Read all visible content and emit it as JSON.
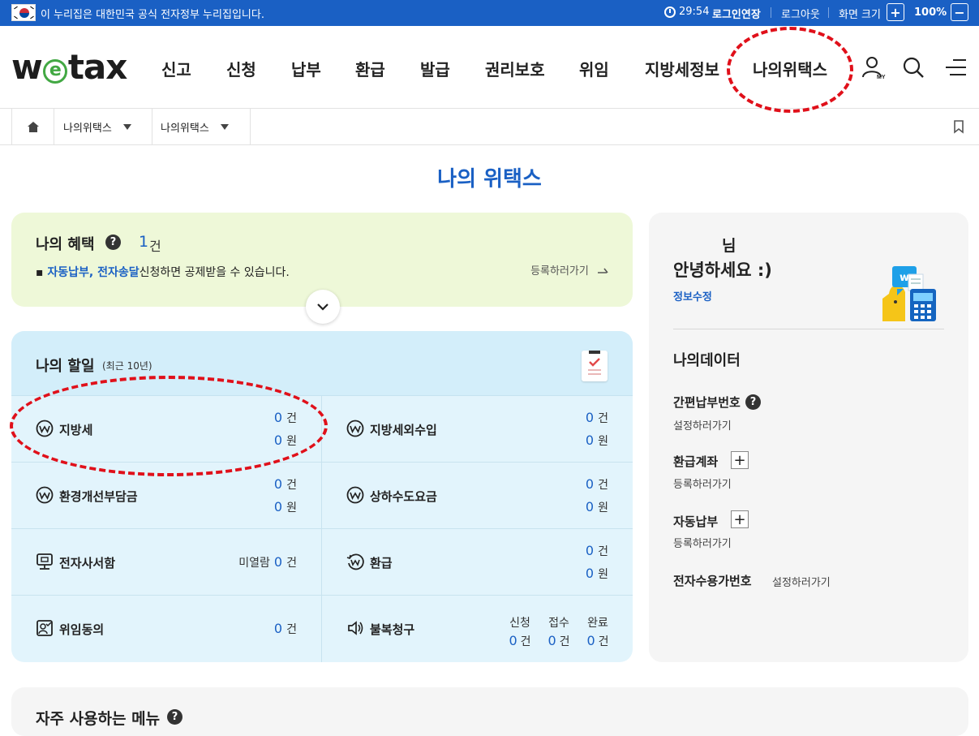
{
  "topbar": {
    "gov_notice": "이 누리집은 대한민국 공식 전자정부 누리집입니다.",
    "timer": "29:54",
    "extend_login": "로그인연장",
    "logout": "로그아웃",
    "zoom_label": "화면 크기",
    "zoom_in": "+",
    "zoom_value": "100%",
    "zoom_out": "−"
  },
  "header": {
    "logo_pre": "w",
    "logo_e": "e",
    "logo_post": "tax",
    "nav": [
      "신고",
      "신청",
      "납부",
      "환급",
      "발급",
      "권리보호",
      "위임",
      "지방세정보",
      "나의위택스"
    ],
    "icons": [
      "user-my-icon",
      "search-icon",
      "menu-icon"
    ],
    "my_label": "MY"
  },
  "breadcrumb": {
    "level1": "나의위택스",
    "level2": "나의위택스"
  },
  "page_title": "나의 위택스",
  "benefit": {
    "title": "나의 혜택",
    "help": "?",
    "count": "1",
    "count_unit": "건",
    "desc_highlight": "자동납부, 전자송달",
    "desc_rest": "신청하면 공제받을 수 있습니다.",
    "register_link": "등록하러가기"
  },
  "todo": {
    "title": "나의 할일",
    "subtitle": "(최근 10년)",
    "items": [
      {
        "name": "지방세",
        "count": "0",
        "count_unit": "건",
        "amount": "0",
        "amount_unit": "원"
      },
      {
        "name": "지방세외수입",
        "count": "0",
        "count_unit": "건",
        "amount": "0",
        "amount_unit": "원"
      },
      {
        "name": "환경개선부담금",
        "count": "0",
        "count_unit": "건",
        "amount": "0",
        "amount_unit": "원"
      },
      {
        "name": "상하수도요금",
        "count": "0",
        "count_unit": "건",
        "amount": "0",
        "amount_unit": "원"
      },
      {
        "name": "전자사서함",
        "prefix": "미열람",
        "count": "0",
        "count_unit": "건"
      },
      {
        "name": "환급",
        "count": "0",
        "count_unit": "건",
        "amount": "0",
        "amount_unit": "원"
      },
      {
        "name": "위임동의",
        "count": "0",
        "count_unit": "건"
      },
      {
        "name": "불복청구",
        "applied_label": "신청",
        "applied": "0",
        "received_label": "접수",
        "received": "0",
        "done_label": "완료",
        "done": "0",
        "unit": "건"
      }
    ]
  },
  "side": {
    "user_suffix": "님",
    "greeting": "안녕하세요 :)",
    "edit_info": "정보수정",
    "data_title": "나의데이터",
    "items": [
      {
        "label": "간편납부번호",
        "help": "?",
        "link": "설정하러가기"
      },
      {
        "label": "환급계좌",
        "plus": "+",
        "link": "등록하러가기"
      },
      {
        "label": "자동납부",
        "plus": "+",
        "link": "등록하러가기"
      },
      {
        "label": "전자수용가번호",
        "link": "설정하러가기"
      }
    ]
  },
  "frequent": {
    "title": "자주 사용하는 메뉴",
    "help": "?"
  },
  "colors": {
    "primary": "#1a60c4",
    "benefit_bg": "#eef8d8",
    "todo_bg": "#e2f4fc",
    "annotation": "#e0101a"
  }
}
